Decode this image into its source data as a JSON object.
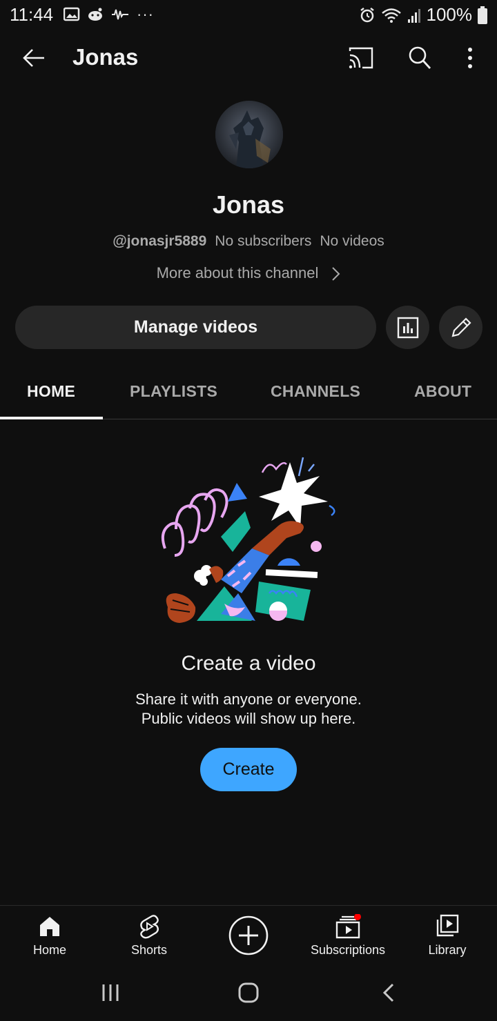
{
  "status_bar": {
    "time": "11:44",
    "battery": "100%",
    "more_dots": "···"
  },
  "header": {
    "title": "Jonas"
  },
  "channel": {
    "name": "Jonas",
    "handle": "@jonasjr5889",
    "subscribers": "No subscribers",
    "videos": "No videos",
    "more_about": "More about this channel",
    "manage_videos": "Manage videos"
  },
  "tabs": [
    {
      "label": "HOME",
      "active": true
    },
    {
      "label": "PLAYLISTS",
      "active": false
    },
    {
      "label": "CHANNELS",
      "active": false
    },
    {
      "label": "ABOUT",
      "active": false
    }
  ],
  "empty_state": {
    "title": "Create a video",
    "line1": "Share it with anyone or everyone.",
    "line2": "Public videos will show up here.",
    "button": "Create"
  },
  "bottom_nav": [
    {
      "label": "Home",
      "icon": "home-icon"
    },
    {
      "label": "Shorts",
      "icon": "shorts-icon"
    },
    {
      "label": "",
      "icon": "add-icon"
    },
    {
      "label": "Subscriptions",
      "icon": "subscriptions-icon"
    },
    {
      "label": "Library",
      "icon": "library-icon"
    }
  ],
  "colors": {
    "background": "#0f0f0f",
    "accent": "#3ea6ff",
    "notification_dot": "#ff0000"
  }
}
